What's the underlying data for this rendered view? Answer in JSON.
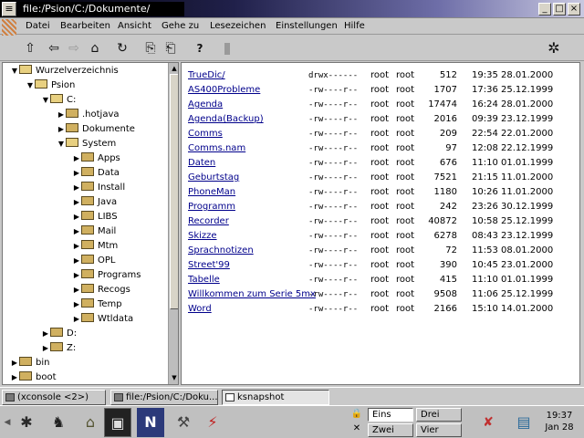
{
  "window": {
    "sys_icon": "≡",
    "title": "file:/Psion/C:/Dokumente/",
    "buttons": {
      "minimize": "_",
      "maximize": "□",
      "close": "×"
    }
  },
  "menu": [
    {
      "label": "Datei"
    },
    {
      "label": "Bearbeiten"
    },
    {
      "label": "Ansicht"
    },
    {
      "label": "Gehe zu"
    },
    {
      "label": "Lesezeichen"
    },
    {
      "label": "Einstellungen"
    },
    {
      "label": "Hilfe"
    }
  ],
  "toolbar": {
    "up": "⇧",
    "back": "⇦",
    "forward": "⇨",
    "home": "⌂",
    "reload": "↻",
    "copy": "⎘",
    "paste": "⎗",
    "help": "?",
    "settings": "✲"
  },
  "tree": [
    {
      "label": "Wurzelverzeichnis",
      "depth": 0,
      "expanded": true
    },
    {
      "label": "Psion",
      "depth": 1,
      "expanded": true
    },
    {
      "label": "C:",
      "depth": 2,
      "expanded": true
    },
    {
      "label": ".hotjava",
      "depth": 3,
      "expanded": false
    },
    {
      "label": "Dokumente",
      "depth": 3,
      "expanded": false
    },
    {
      "label": "System",
      "depth": 3,
      "expanded": true
    },
    {
      "label": "Apps",
      "depth": 4,
      "expanded": false
    },
    {
      "label": "Data",
      "depth": 4,
      "expanded": false
    },
    {
      "label": "Install",
      "depth": 4,
      "expanded": false
    },
    {
      "label": "Java",
      "depth": 4,
      "expanded": false
    },
    {
      "label": "LIBS",
      "depth": 4,
      "expanded": false
    },
    {
      "label": "Mail",
      "depth": 4,
      "expanded": false
    },
    {
      "label": "Mtm",
      "depth": 4,
      "expanded": false
    },
    {
      "label": "OPL",
      "depth": 4,
      "expanded": false
    },
    {
      "label": "Programs",
      "depth": 4,
      "expanded": false
    },
    {
      "label": "Recogs",
      "depth": 4,
      "expanded": false
    },
    {
      "label": "Temp",
      "depth": 4,
      "expanded": false
    },
    {
      "label": "Wtldata",
      "depth": 4,
      "expanded": false
    },
    {
      "label": "D:",
      "depth": 2,
      "expanded": false
    },
    {
      "label": "Z:",
      "depth": 2,
      "expanded": false
    },
    {
      "label": "bin",
      "depth": 0,
      "expanded": false
    },
    {
      "label": "boot",
      "depth": 0,
      "expanded": false
    }
  ],
  "files": [
    {
      "name": "TrueDic/",
      "perm": "drwx------",
      "owner": "root",
      "group": "root",
      "size": "512",
      "date": "19:35 28.01.2000"
    },
    {
      "name": "AS400Probleme",
      "perm": "-rw----r--",
      "owner": "root",
      "group": "root",
      "size": "1707",
      "date": "17:36 25.12.1999"
    },
    {
      "name": "Agenda",
      "perm": "-rw----r--",
      "owner": "root",
      "group": "root",
      "size": "17474",
      "date": "16:24 28.01.2000"
    },
    {
      "name": "Agenda(Backup)",
      "perm": "-rw----r--",
      "owner": "root",
      "group": "root",
      "size": "2016",
      "date": "09:39 23.12.1999"
    },
    {
      "name": "Comms",
      "perm": "-rw----r--",
      "owner": "root",
      "group": "root",
      "size": "209",
      "date": "22:54 22.01.2000"
    },
    {
      "name": "Comms.nam",
      "perm": "-rw----r--",
      "owner": "root",
      "group": "root",
      "size": "97",
      "date": "12:08 22.12.1999"
    },
    {
      "name": "Daten",
      "perm": "-rw----r--",
      "owner": "root",
      "group": "root",
      "size": "676",
      "date": "11:10 01.01.1999"
    },
    {
      "name": "Geburtstag",
      "perm": "-rw----r--",
      "owner": "root",
      "group": "root",
      "size": "7521",
      "date": "21:15 11.01.2000"
    },
    {
      "name": "PhoneMan",
      "perm": "-rw----r--",
      "owner": "root",
      "group": "root",
      "size": "1180",
      "date": "10:26 11.01.2000"
    },
    {
      "name": "Programm",
      "perm": "-rw----r--",
      "owner": "root",
      "group": "root",
      "size": "242",
      "date": "23:26 30.12.1999"
    },
    {
      "name": "Recorder",
      "perm": "-rw----r--",
      "owner": "root",
      "group": "root",
      "size": "40872",
      "date": "10:58 25.12.1999"
    },
    {
      "name": "Skizze",
      "perm": "-rw----r--",
      "owner": "root",
      "group": "root",
      "size": "6278",
      "date": "08:43 23.12.1999"
    },
    {
      "name": "Sprachnotizen",
      "perm": "-rw----r--",
      "owner": "root",
      "group": "root",
      "size": "72",
      "date": "11:53 08.01.2000"
    },
    {
      "name": "Street'99",
      "perm": "-rw----r--",
      "owner": "root",
      "group": "root",
      "size": "390",
      "date": "10:45 23.01.2000"
    },
    {
      "name": "Tabelle",
      "perm": "-rw----r--",
      "owner": "root",
      "group": "root",
      "size": "415",
      "date": "11:10 01.01.1999"
    },
    {
      "name": "Willkommen zum Serie 5mx",
      "perm": "-rw----r--",
      "owner": "root",
      "group": "root",
      "size": "9508",
      "date": "11:06 25.12.1999"
    },
    {
      "name": "Word",
      "perm": "-rw----r--",
      "owner": "root",
      "group": "root",
      "size": "2166",
      "date": "15:10 14.01.2000"
    }
  ],
  "tasks": [
    {
      "label": "(xconsole <2>)",
      "active": false
    },
    {
      "label": "file:/Psion/C:/Doku...",
      "active": false
    },
    {
      "label": "ksnapshot",
      "active": true
    }
  ],
  "desktops": [
    {
      "label": "Eins",
      "active": true
    },
    {
      "label": "Drei",
      "active": false
    },
    {
      "label": "Zwei",
      "active": false
    },
    {
      "label": "Vier",
      "active": false
    }
  ],
  "clock": {
    "time": "19:37",
    "date": "Jan 28"
  },
  "colors": {
    "link": "#00008b",
    "title_grad_end": "#c8c8e0"
  }
}
